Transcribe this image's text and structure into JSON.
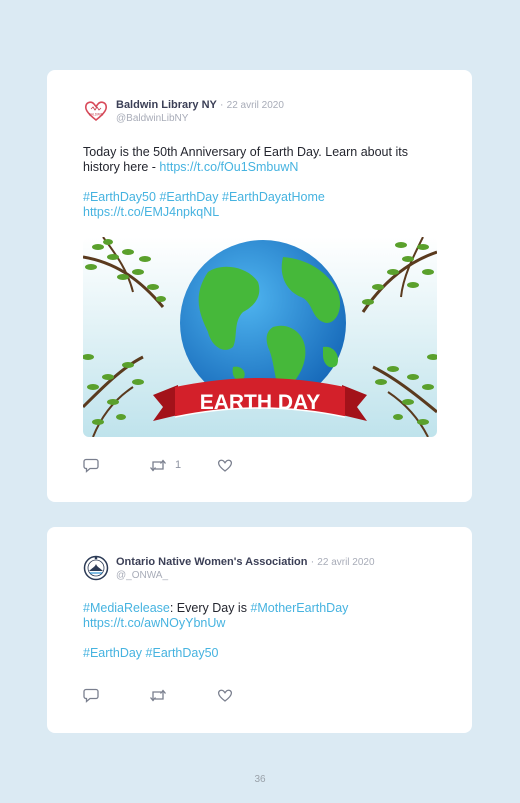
{
  "tweets": [
    {
      "author": "Baldwin Library NY",
      "separator": "·",
      "date": "22 avril 2020",
      "handle": "@BaldwinLibNY",
      "line1": "Today is the 50th Anniversary of Earth Day. Learn about its",
      "line2_text": "history here - ",
      "line2_link": "https://t.co/fOu1SmbuwN",
      "hashtags": [
        "#EarthDay50",
        "#EarthDay",
        "#EarthDayatHome"
      ],
      "link2": "https://t.co/EMJ4npkqNL",
      "media_banner": "EARTH DAY",
      "retweet_count": "1",
      "avatar_icon": "heart-icon"
    },
    {
      "author": "Ontario Native Women's Association",
      "separator": "·",
      "date": "22 avril 2020",
      "handle": "@_ONWA_",
      "hashtag1": "#MediaRelease",
      "text_mid": ": Every Day is ",
      "hashtag2": "#MotherEarthDay",
      "link": "https://t.co/awNOyYbnUw",
      "hashtags": [
        "#EarthDay",
        "#EarthDay50"
      ],
      "avatar_icon": "onwa-logo-icon"
    }
  ],
  "page_number": "36",
  "colors": {
    "background": "#dbeaf3",
    "card": "#ffffff",
    "link": "#46b3e0",
    "name": "#3b3f56",
    "muted": "#a8acb8"
  }
}
